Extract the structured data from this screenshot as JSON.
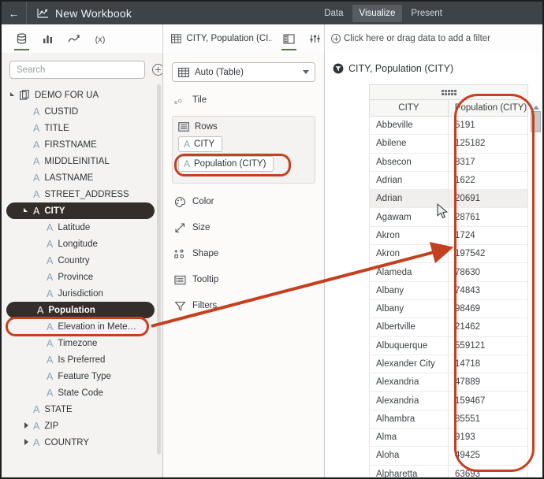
{
  "header": {
    "back_icon": "back-arrow-icon",
    "workbook_icon": "workbook-chart-icon",
    "title": "New Workbook",
    "nav": [
      {
        "label": "Data",
        "active": false
      },
      {
        "label": "Visualize",
        "active": true
      },
      {
        "label": "Present",
        "active": false
      }
    ]
  },
  "toolbar": {
    "left_icons": [
      {
        "name": "database-icon",
        "selected": true
      },
      {
        "name": "bar-chart-icon",
        "selected": false
      },
      {
        "name": "trend-line-icon",
        "selected": false
      },
      {
        "name": "calculation-fx-icon",
        "selected": false
      }
    ],
    "sheet_tab": {
      "icon": "table-grid-icon",
      "label": "CITY, Population (CI..."
    },
    "mid_icons": [
      {
        "name": "layout-panel-icon",
        "selected": true
      },
      {
        "name": "settings-sliders-icon",
        "selected": false
      }
    ],
    "filter_hint": "Click here or drag data to add a filter",
    "filter_add_icon": "plus-circle-icon"
  },
  "sidebar": {
    "search_placeholder": "Search",
    "search_value": "",
    "add_icon": "add-circle-icon",
    "tree": [
      {
        "label": "DEMO FOR UA",
        "level": 0,
        "caret": "down",
        "glyph": "datasource",
        "selected": false
      },
      {
        "label": "CUSTID",
        "level": 1,
        "caret": "none",
        "glyph": "A",
        "selected": false
      },
      {
        "label": "TITLE",
        "level": 1,
        "caret": "none",
        "glyph": "A",
        "selected": false
      },
      {
        "label": "FIRSTNAME",
        "level": 1,
        "caret": "none",
        "glyph": "A",
        "selected": false
      },
      {
        "label": "MIDDLEINITIAL",
        "level": 1,
        "caret": "none",
        "glyph": "A",
        "selected": false
      },
      {
        "label": "LASTNAME",
        "level": 1,
        "caret": "none",
        "glyph": "A",
        "selected": false
      },
      {
        "label": "STREET_ADDRESS",
        "level": 1,
        "caret": "none",
        "glyph": "A",
        "selected": false
      },
      {
        "label": "CITY",
        "level": 1,
        "caret": "down",
        "glyph": "A",
        "selected": true
      },
      {
        "label": "Latitude",
        "level": 2,
        "caret": "none",
        "glyph": "A",
        "selected": false
      },
      {
        "label": "Longitude",
        "level": 2,
        "caret": "none",
        "glyph": "A",
        "selected": false
      },
      {
        "label": "Country",
        "level": 2,
        "caret": "none",
        "glyph": "A",
        "selected": false
      },
      {
        "label": "Province",
        "level": 2,
        "caret": "none",
        "glyph": "A",
        "selected": false
      },
      {
        "label": "Jurisdiction",
        "level": 2,
        "caret": "none",
        "glyph": "A",
        "selected": false
      },
      {
        "label": "Population",
        "level": 2,
        "caret": "none",
        "glyph": "A",
        "selected": true
      },
      {
        "label": "Elevation in Mete…",
        "level": 2,
        "caret": "none",
        "glyph": "A",
        "selected": false
      },
      {
        "label": "Timezone",
        "level": 2,
        "caret": "none",
        "glyph": "A",
        "selected": false
      },
      {
        "label": "Is Preferred",
        "level": 2,
        "caret": "none",
        "glyph": "A",
        "selected": false
      },
      {
        "label": "Feature Type",
        "level": 2,
        "caret": "none",
        "glyph": "A",
        "selected": false
      },
      {
        "label": "State Code",
        "level": 2,
        "caret": "none",
        "glyph": "A",
        "selected": false
      },
      {
        "label": "STATE",
        "level": 1,
        "caret": "none",
        "glyph": "A",
        "selected": false
      },
      {
        "label": "ZIP",
        "level": 1,
        "caret": "right",
        "glyph": "A",
        "selected": false
      },
      {
        "label": "COUNTRY",
        "level": 1,
        "caret": "right",
        "glyph": "A",
        "selected": false
      }
    ]
  },
  "shelf": {
    "mark_type": {
      "icon": "table-grid-icon",
      "label": "Auto (Table)",
      "caret": "chevron-down-icon"
    },
    "tile": {
      "icon": "tile-icon",
      "label": "Tile"
    },
    "rows": {
      "icon": "rows-icon",
      "label": "Rows",
      "pills": [
        {
          "glyph": "A",
          "label": "CITY"
        },
        {
          "glyph": "A",
          "label": "Population (CITY)"
        }
      ]
    },
    "properties": [
      {
        "icon": "color-palette-icon",
        "label": "Color"
      },
      {
        "icon": "size-icon",
        "label": "Size"
      },
      {
        "icon": "shape-icon",
        "label": "Shape"
      },
      {
        "icon": "tooltip-icon",
        "label": "Tooltip"
      },
      {
        "icon": "filter-funnel-icon",
        "label": "Filters"
      }
    ]
  },
  "viz": {
    "title_icon": "filter-badge-icon",
    "title": "CITY, Population (CITY)",
    "grip_icon": "drag-grip-icon",
    "columns": [
      "CITY",
      "Population (CITY)"
    ],
    "rows": [
      [
        "Abbeville",
        "5191"
      ],
      [
        "Abilene",
        "125182"
      ],
      [
        "Absecon",
        "8317"
      ],
      [
        "Adrian",
        "1622"
      ],
      [
        "Adrian",
        "20691"
      ],
      [
        "Agawam",
        "28761"
      ],
      [
        "Akron",
        "1724"
      ],
      [
        "Akron",
        "197542"
      ],
      [
        "Alameda",
        "78630"
      ],
      [
        "Albany",
        "74843"
      ],
      [
        "Albany",
        "98469"
      ],
      [
        "Albertville",
        "21462"
      ],
      [
        "Albuquerque",
        "559121"
      ],
      [
        "Alexander City",
        "14718"
      ],
      [
        "Alexandria",
        "47889"
      ],
      [
        "Alexandria",
        "159467"
      ],
      [
        "Alhambra",
        "85551"
      ],
      [
        "Alma",
        "9193"
      ],
      [
        "Aloha",
        "49425"
      ],
      [
        "Alpharetta",
        "63693"
      ]
    ],
    "highlighted_row_index": 4,
    "scroll_up_icon": "scroll-up-arrow-icon",
    "scrollbar_thumb": "vertical-scrollbar-thumb"
  },
  "annotations": {
    "accent_color": "#c5401f",
    "boxes": [
      {
        "name": "population-field-highlight"
      },
      {
        "name": "population-pill-highlight"
      },
      {
        "name": "population-column-highlight"
      }
    ],
    "arrow": {
      "name": "population-to-column-arrow"
    }
  },
  "cursor": {
    "name": "mouse-pointer"
  }
}
